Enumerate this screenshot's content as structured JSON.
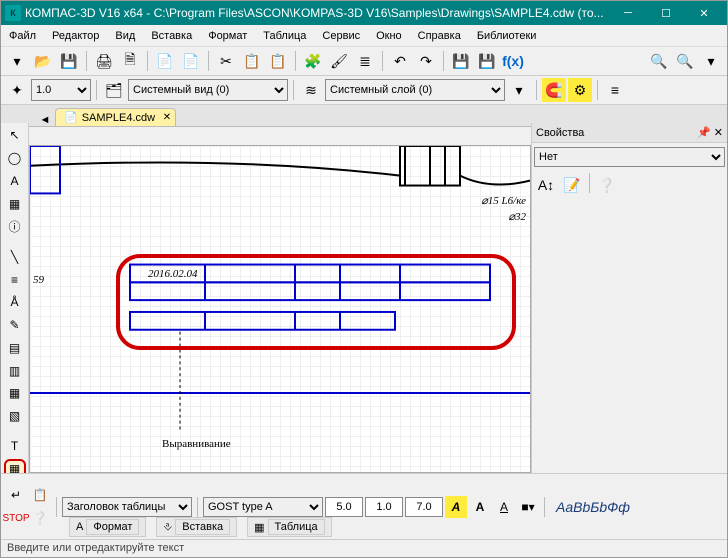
{
  "titlebar": {
    "app": "КОМПАС-3D V16  x64",
    "path": "C:\\Program Files\\ASCON\\KOMPAS-3D V16\\Samples\\Drawings\\SAMPLE4.cdw (то..."
  },
  "menu": {
    "file": "Файл",
    "editor": "Редактор",
    "view": "Вид",
    "insert": "Вставка",
    "format": "Формат",
    "table": "Таблица",
    "service": "Сервис",
    "window": "Окно",
    "help": "Справка",
    "libs": "Библиотеки"
  },
  "toolbar2": {
    "scale": "1.0",
    "view_combo": "Системный вид (0)",
    "layer_combo": "Системный слой (0)"
  },
  "tab": {
    "name": "SAMPLE4.cdw"
  },
  "canvas": {
    "dim1": "59",
    "date": "2016.02.04",
    "note": "Выравнивание",
    "dimA": "⌀15 L6/ке",
    "dimB": "⌀32"
  },
  "props": {
    "title": "Свойства",
    "filter": "Нет"
  },
  "bottom": {
    "section": "Заголовок таблицы",
    "font": "GOST type A",
    "size": "5.0",
    "step": "1.0",
    "width": "7.0",
    "preview": "АаВbБbФф",
    "tab_format": "Формат",
    "tab_insert": "Вставка",
    "tab_table": "Таблица"
  },
  "status": {
    "msg": "Введите или отредактируйте текст"
  }
}
